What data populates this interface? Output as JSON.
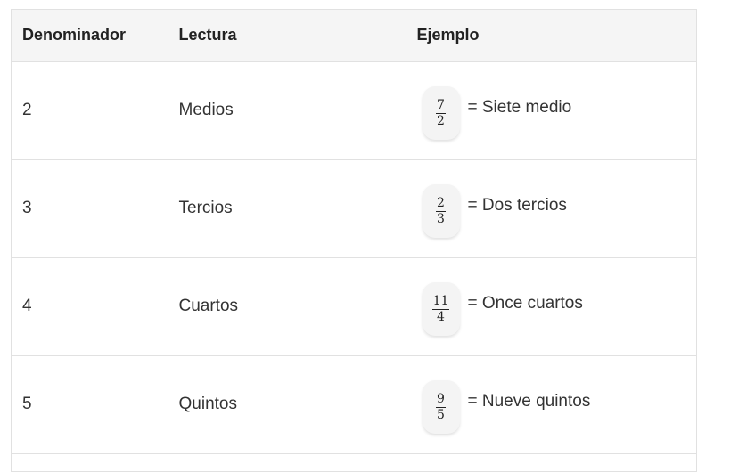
{
  "table": {
    "headers": [
      "Denominador",
      "Lectura",
      "Ejemplo"
    ],
    "rows": [
      {
        "denominator": "2",
        "reading": "Medios",
        "example": {
          "numerator": "7",
          "denominator": "2",
          "text": "= Siete medio"
        }
      },
      {
        "denominator": "3",
        "reading": "Tercios",
        "example": {
          "numerator": "2",
          "denominator": "3",
          "text": "= Dos tercios"
        }
      },
      {
        "denominator": "4",
        "reading": "Cuartos",
        "example": {
          "numerator": "11",
          "denominator": "4",
          "text": "= Once cuartos"
        }
      },
      {
        "denominator": "5",
        "reading": "Quintos",
        "example": {
          "numerator": "9",
          "denominator": "5",
          "text": "= Nueve quintos"
        }
      }
    ]
  }
}
